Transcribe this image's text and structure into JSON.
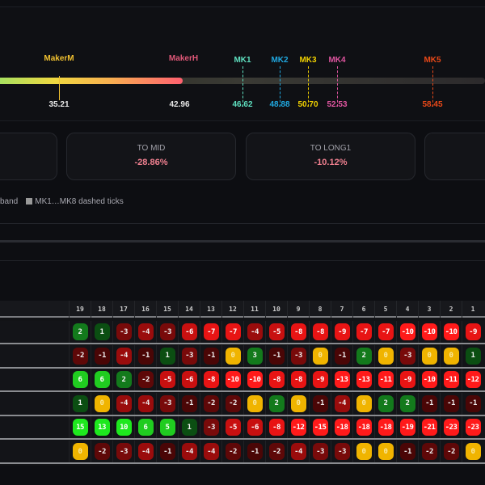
{
  "scale": {
    "makers": [
      {
        "label": "MakerM",
        "value": "35.21",
        "color": "#f0c030",
        "value_color": "#e8e8e8"
      },
      {
        "label": "MakerH",
        "value": "42.96",
        "color": "#e05878",
        "value_color": "#e8e8e8"
      }
    ],
    "ticks": [
      {
        "label": "MK1",
        "value": "46.62",
        "color": "#5fe0c0"
      },
      {
        "label": "MK2",
        "value": "48.88",
        "color": "#20a8e0"
      },
      {
        "label": "MK3",
        "value": "50.70",
        "color": "#f0d000"
      },
      {
        "label": "MK4",
        "value": "52.53",
        "color": "#e055a0"
      },
      {
        "label": "MK5",
        "value": "58.45",
        "color": "#e84818"
      }
    ]
  },
  "cards": [
    {
      "title": "",
      "value": ""
    },
    {
      "title": "TO MID",
      "value": "-28.86%"
    },
    {
      "title": "TO LONG1",
      "value": "-10.12%"
    },
    {
      "title": "",
      "value": ""
    }
  ],
  "legend": {
    "item1": "band",
    "item2": "MK1…MK8 dashed ticks"
  },
  "table": {
    "headers": [
      "19",
      "18",
      "17",
      "16",
      "15",
      "14",
      "13",
      "12",
      "11",
      "10",
      "9",
      "8",
      "7",
      "6",
      "5",
      "4",
      "3",
      "2",
      "1"
    ],
    "rows": [
      [
        2,
        1,
        -3,
        -4,
        -3,
        -6,
        -7,
        -7,
        -4,
        -5,
        -8,
        -8,
        -9,
        -7,
        -7,
        -10,
        -10,
        -10,
        -9
      ],
      [
        -2,
        -1,
        -4,
        -1,
        1,
        -3,
        -1,
        0,
        3,
        -1,
        -3,
        0,
        -1,
        2,
        0,
        -3,
        0,
        0,
        1
      ],
      [
        6,
        6,
        2,
        -2,
        -5,
        -6,
        -8,
        -10,
        -10,
        -8,
        -8,
        -9,
        -13,
        -13,
        -11,
        -9,
        -10,
        -11,
        -12
      ],
      [
        1,
        0,
        -4,
        -4,
        -3,
        -1,
        -2,
        -2,
        0,
        2,
        0,
        -1,
        -4,
        0,
        2,
        2,
        -1,
        -1,
        -1
      ],
      [
        15,
        13,
        10,
        6,
        5,
        1,
        -3,
        -5,
        -6,
        -8,
        -12,
        -15,
        -18,
        -18,
        -18,
        -19,
        -21,
        -23,
        -23
      ],
      [
        0,
        -2,
        -3,
        -4,
        -1,
        -4,
        -4,
        -2,
        -1,
        -2,
        -4,
        -3,
        -3,
        0,
        0,
        -1,
        -2,
        -2,
        0
      ]
    ]
  }
}
